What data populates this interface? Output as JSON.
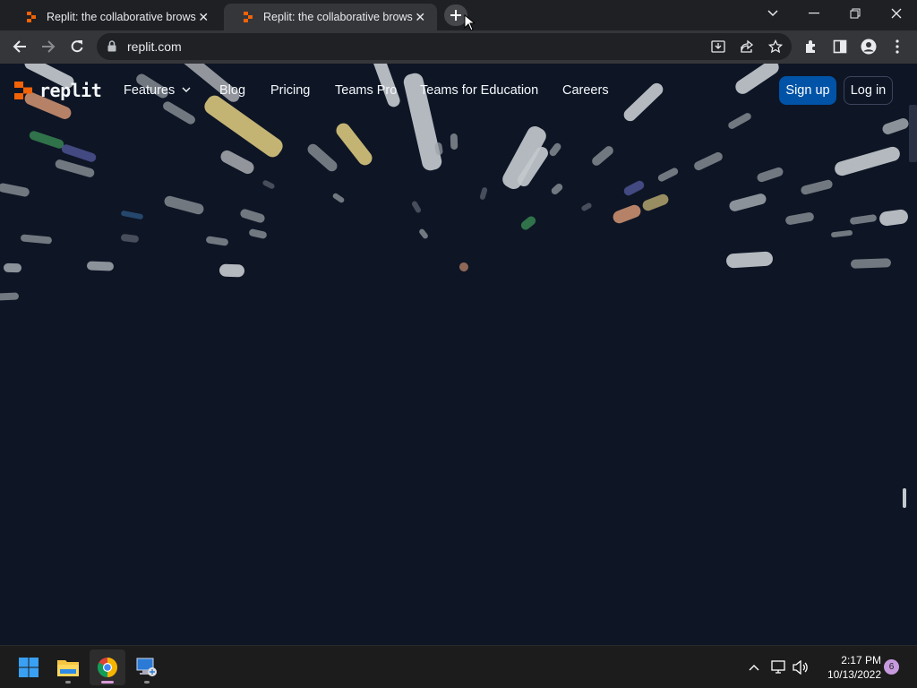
{
  "browser": {
    "tabs": [
      {
        "title": "Replit: the collaborative browser",
        "active": false
      },
      {
        "title": "Replit: the collaborative browser",
        "active": true
      }
    ],
    "url": "replit.com",
    "icons": {
      "back": "arrow-left-icon",
      "forward": "arrow-right-icon",
      "reload": "reload-icon",
      "lock": "lock-icon",
      "install": "install-app-icon",
      "share": "share-icon",
      "bookmark": "star-icon",
      "extensions": "puzzle-icon",
      "sidepanel": "side-panel-icon",
      "profile": "profile-icon",
      "menu": "kebab-menu-icon"
    }
  },
  "site": {
    "logo_text": "replit",
    "nav": {
      "features": "Features",
      "blog": "Blog",
      "pricing": "Pricing",
      "teams_pro": "Teams Pro",
      "teams_edu": "Teams for Education",
      "careers": "Careers"
    },
    "signup": "Sign up",
    "login": "Log in",
    "colors": {
      "background": "#0e1525",
      "primary_button": "#0053a6",
      "logo_orange": "#f26207"
    }
  },
  "taskbar": {
    "apps": [
      "windows-start-icon",
      "file-explorer-icon",
      "chrome-icon",
      "remote-desktop-icon"
    ],
    "clock_time": "2:17 PM",
    "clock_date": "10/13/2022",
    "notification_count": "6"
  }
}
